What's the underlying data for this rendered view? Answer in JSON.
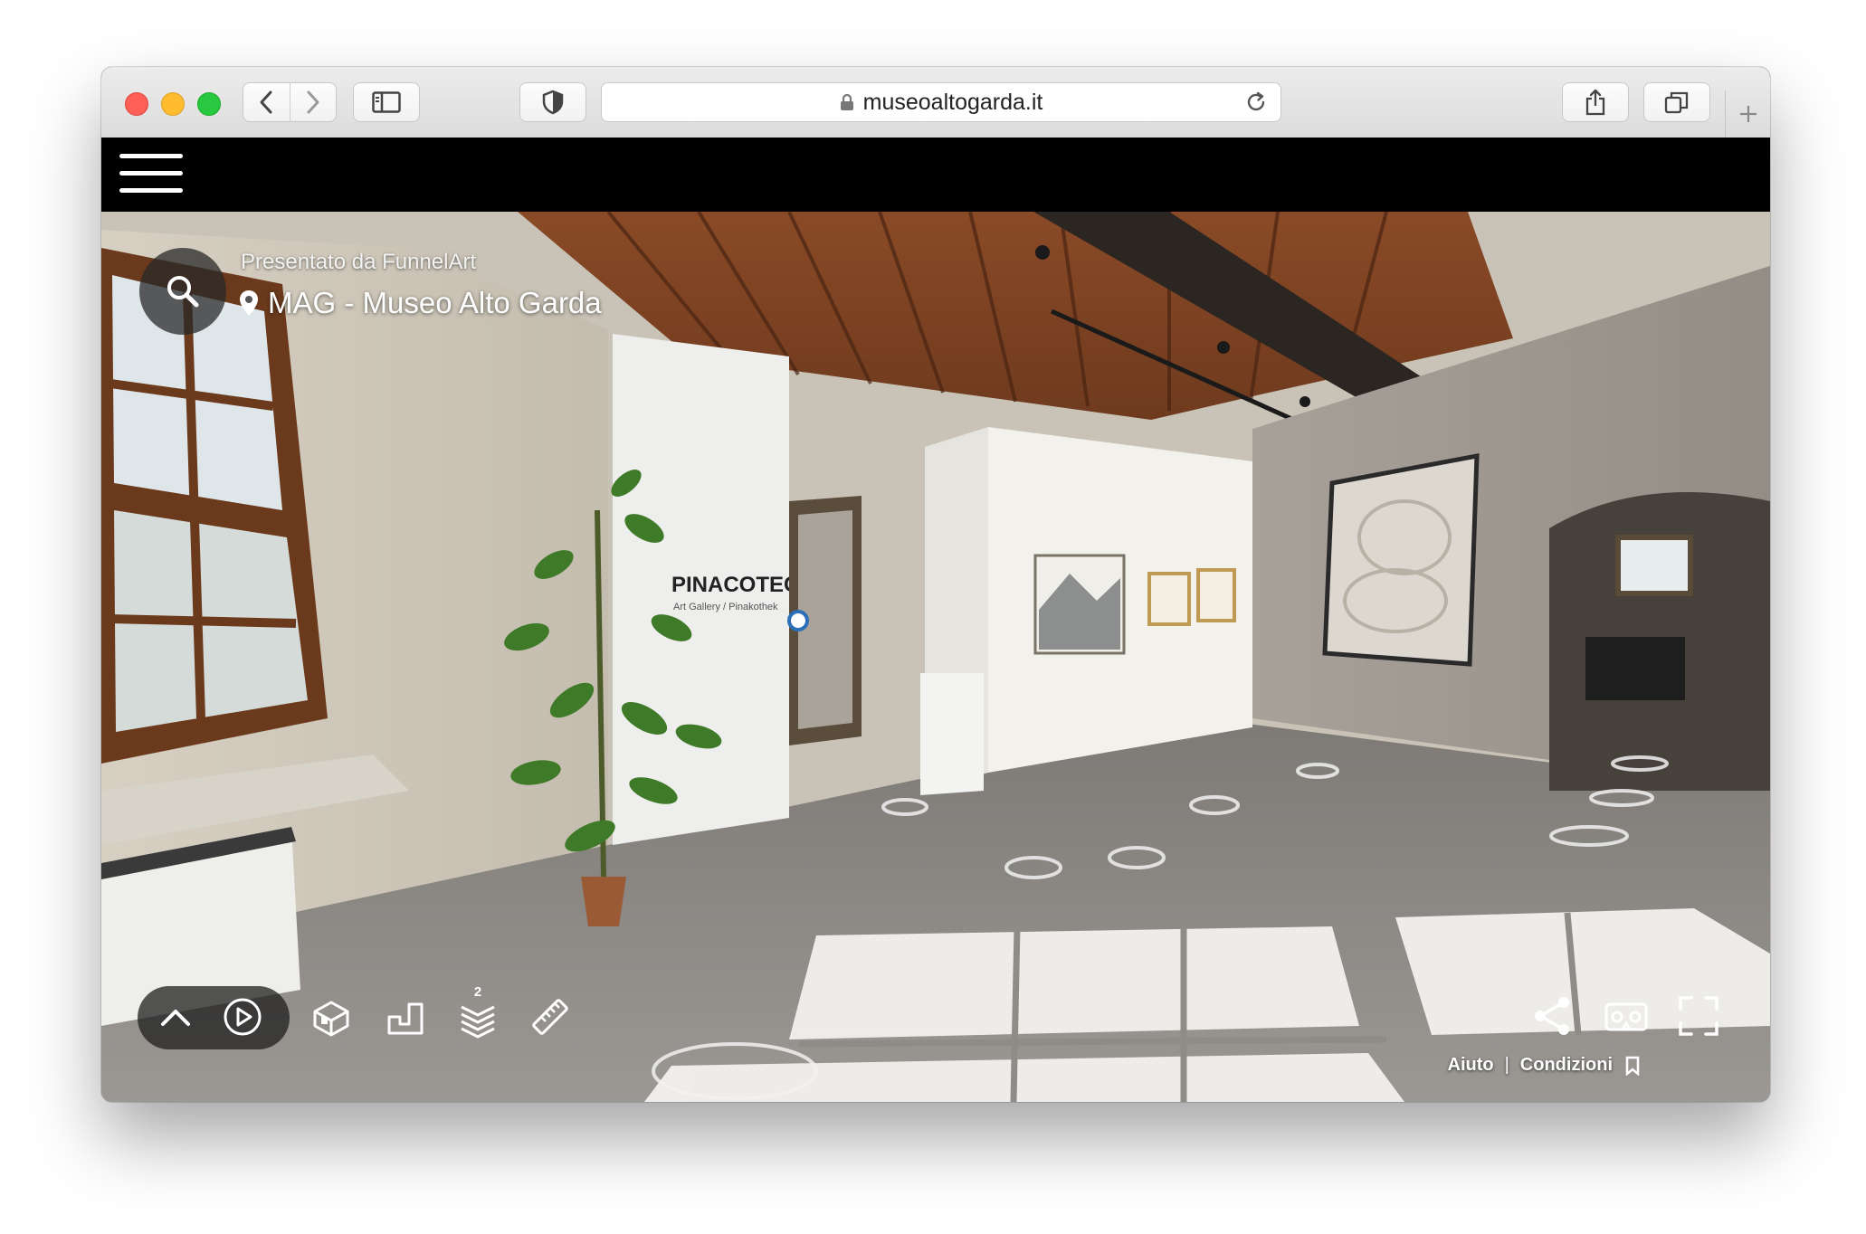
{
  "browser": {
    "url": "museoaltogarda.it",
    "icons": {
      "back": "chevron-left-icon",
      "forward": "chevron-right-icon",
      "sidebar": "sidebar-icon",
      "privacy": "shield-icon",
      "lock": "lock-icon",
      "reload": "reload-icon",
      "share": "share-icon",
      "tabs": "tabs-overview-icon",
      "new_tab": "plus-icon"
    }
  },
  "tour": {
    "presented_by": "Presentato da FunnelArt",
    "venue": "MAG - Museo Alto Garda",
    "wall_sign_title": "PINACOTECA",
    "wall_sign_subtitle": "Art Gallery / Pinakothek",
    "floor_badge": "2",
    "footer": {
      "help": "Aiuto",
      "separator": "|",
      "terms": "Condizioni"
    }
  }
}
